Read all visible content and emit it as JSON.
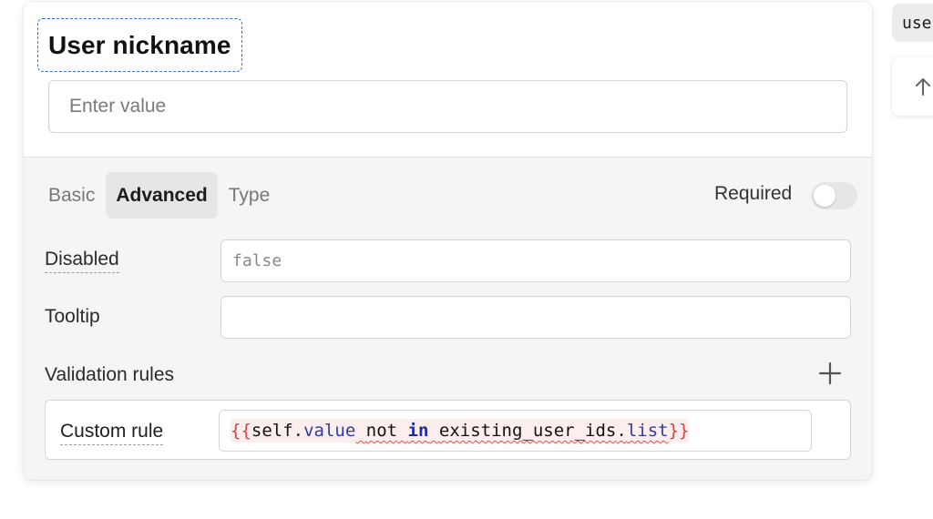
{
  "field": {
    "title": "User nickname",
    "placeholder": "Enter value"
  },
  "tabs": [
    {
      "label": "Basic",
      "active": false
    },
    {
      "label": "Advanced",
      "active": true
    },
    {
      "label": "Type",
      "active": false
    }
  ],
  "required": {
    "label": "Required",
    "on": false
  },
  "disabled": {
    "label": "Disabled",
    "value": "false"
  },
  "tooltip": {
    "label": "Tooltip",
    "value": ""
  },
  "validation": {
    "label": "Validation rules",
    "add_icon": "plus-icon",
    "rules": [
      {
        "label": "Custom rule",
        "expression": "{{self.value not in existing_user_ids.list}}",
        "tokens": {
          "open": "{{",
          "self": "self",
          "dot1": ".",
          "value": "value",
          "sp1": " ",
          "not": "not",
          "sp2": " ",
          "in": "in",
          "sp3": " ",
          "ids": "existing_user_ids",
          "dot2": ".",
          "list": "list",
          "close": "}}"
        }
      }
    ]
  },
  "side": {
    "chip_text": "user",
    "icon": "arrow-up-icon"
  },
  "colors": {
    "focus_outline": "#3b6fe0",
    "brace": "#d0453e",
    "keyword": "#1f2aa3",
    "error_squiggle": "#e05050"
  }
}
